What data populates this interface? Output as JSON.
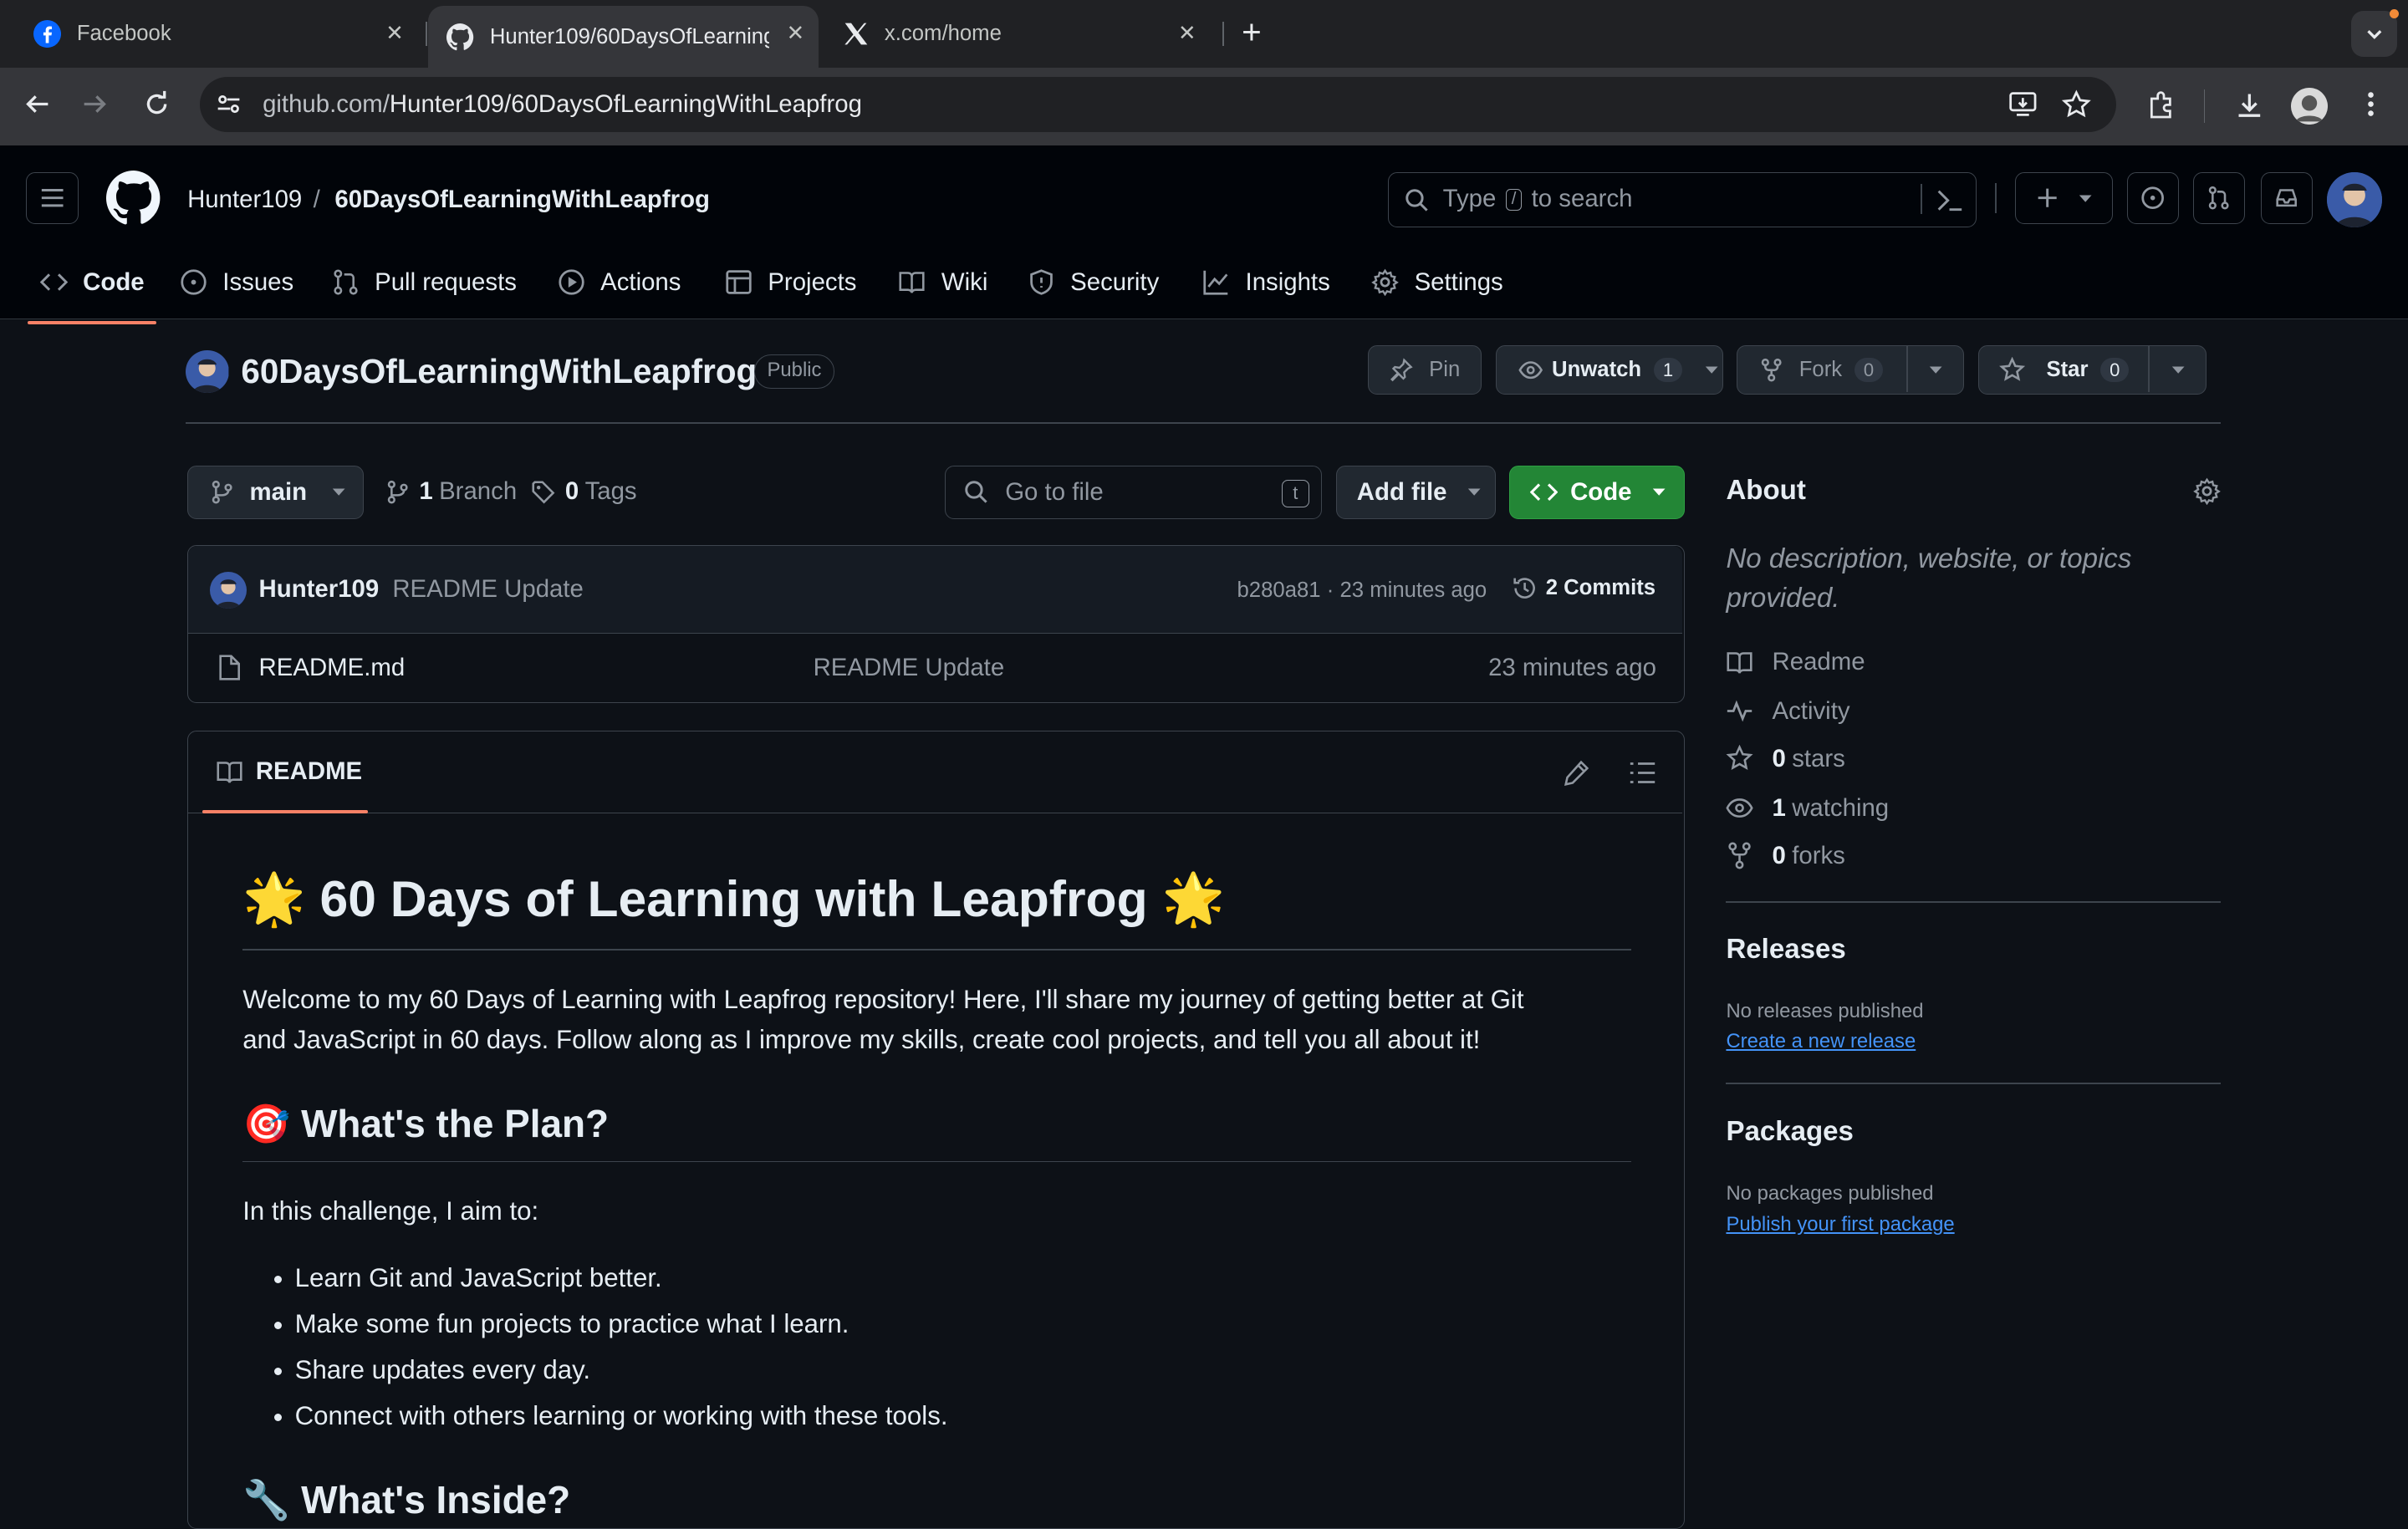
{
  "browser": {
    "tabs": [
      {
        "title": "Facebook",
        "favicon": "facebook-icon"
      },
      {
        "title": "Hunter109/60DaysOfLearningWithLeapfrog",
        "favicon": "github-icon"
      },
      {
        "title": "x.com/home",
        "favicon": "x-logo-icon"
      }
    ],
    "url_host": "github.com/",
    "url_path": "Hunter109/60DaysOfLearningWithLeapfrog"
  },
  "header": {
    "owner": "Hunter109",
    "separator": "/",
    "repo": "60DaysOfLearningWithLeapfrog",
    "search_prefix": "Type",
    "search_key": "/",
    "search_suffix": "to search"
  },
  "nav": {
    "tabs": [
      {
        "label": "Code",
        "icon": "code-icon"
      },
      {
        "label": "Issues",
        "icon": "issue-icon"
      },
      {
        "label": "Pull requests",
        "icon": "pull-request-icon"
      },
      {
        "label": "Actions",
        "icon": "play-icon"
      },
      {
        "label": "Projects",
        "icon": "table-icon"
      },
      {
        "label": "Wiki",
        "icon": "book-icon"
      },
      {
        "label": "Security",
        "icon": "shield-icon"
      },
      {
        "label": "Insights",
        "icon": "graph-icon"
      },
      {
        "label": "Settings",
        "icon": "gear-icon"
      }
    ]
  },
  "repo": {
    "name": "60DaysOfLearningWithLeapfrog",
    "visibility": "Public",
    "pin_label": "Pin",
    "unwatch_label": "Unwatch",
    "watch_count": "1",
    "fork_label": "Fork",
    "fork_count": "0",
    "star_label": "Star",
    "star_count": "0"
  },
  "filebar": {
    "branch": "main",
    "branch_count": "1",
    "branch_label": "Branch",
    "tag_count": "0",
    "tag_label": "Tags",
    "goto_placeholder": "Go to file",
    "goto_key": "t",
    "add_file": "Add file",
    "code_button": "Code"
  },
  "commit": {
    "author": "Hunter109",
    "message": "README Update",
    "hash": "b280a81",
    "dot": "·",
    "time": "23 minutes ago",
    "commit_count": "2 Commits"
  },
  "files": [
    {
      "name": "README.md",
      "message": "README Update",
      "time": "23 minutes ago"
    }
  ],
  "readme": {
    "tab_label": "README",
    "title": "🌟 60 Days of Learning with Leapfrog 🌟",
    "intro_line1": "Welcome to my 60 Days of Learning with Leapfrog repository! Here, I'll share my journey of getting better at Git",
    "intro_line2": "and JavaScript in 60 days. Follow along as I improve my skills, create cool projects, and tell you all about it!",
    "plan_heading": "🎯 What's the Plan?",
    "plan_intro": "In this challenge, I aim to:",
    "plan_items": [
      "Learn Git and JavaScript better.",
      "Make some fun projects to practice what I learn.",
      "Share updates every day.",
      "Connect with others learning or working with these tools."
    ],
    "inside_heading": "🔧 What's Inside?"
  },
  "about": {
    "heading": "About",
    "description_line1": "No description, website, or topics",
    "description_line2": "provided.",
    "readme": "Readme",
    "activity": "Activity",
    "stars_count": "0",
    "stars_label": "stars",
    "watching_count": "1",
    "watching_label": "watching",
    "forks_count": "0",
    "forks_label": "forks"
  },
  "releases": {
    "heading": "Releases",
    "empty": "No releases published",
    "link": "Create a new release"
  },
  "packages": {
    "heading": "Packages",
    "empty": "No packages published",
    "link": "Publish your first package"
  },
  "colors": {
    "accent_underline": "#f78166",
    "code_button": "#238636",
    "link": "#4493f8",
    "background": "#0d1117"
  }
}
